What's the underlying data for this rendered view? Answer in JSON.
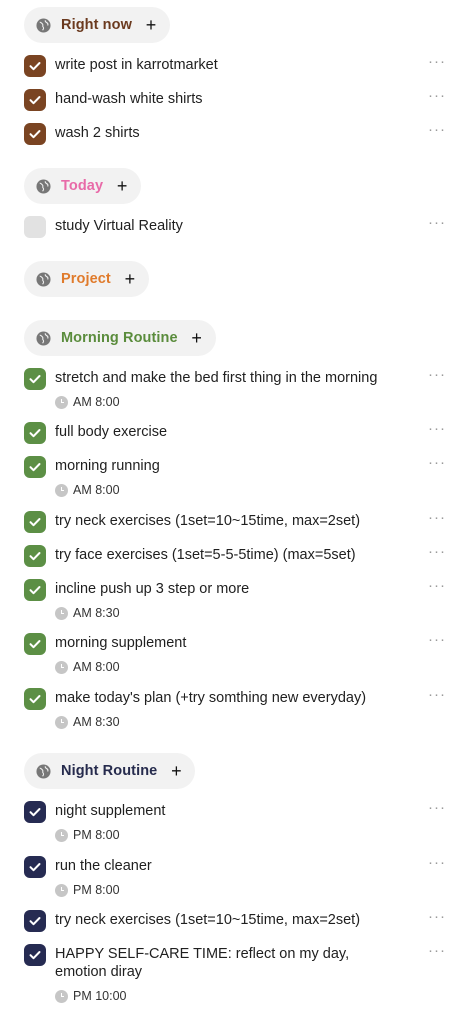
{
  "colors": {
    "right_now": "#6b3a1f",
    "today": "#e86aa8",
    "project": "#e07b2c",
    "morning": "#5a8c3c",
    "night": "#262b4d",
    "check_brown": "#7a4422",
    "check_green": "#5c8f45",
    "check_navy": "#262b52",
    "check_empty": "#e2e2e2"
  },
  "sections": {
    "right_now": {
      "title": "Right now",
      "plus": "+"
    },
    "today": {
      "title": "Today",
      "plus": "+"
    },
    "project": {
      "title": "Project",
      "plus": "+"
    },
    "morning": {
      "title": "Morning Routine",
      "plus": "+"
    },
    "night": {
      "title": "Night Routine",
      "plus": "+"
    }
  },
  "more_label": "···",
  "tasks": {
    "t1": {
      "title": "write post in karrotmarket",
      "done": true
    },
    "t2": {
      "title": "hand-wash white shirts",
      "done": true
    },
    "t3": {
      "title": "wash 2 shirts",
      "done": true
    },
    "t4": {
      "title": "study Virtual Reality",
      "done": false
    },
    "m1": {
      "title": "stretch and make the bed first thing in the morning",
      "time": "AM 8:00",
      "done": true
    },
    "m2": {
      "title": "full body exercise",
      "done": true
    },
    "m3": {
      "title": "morning running",
      "time": "AM 8:00",
      "done": true
    },
    "m4": {
      "title": "try neck exercises (1set=10~15time, max=2set)",
      "done": true
    },
    "m5": {
      "title": "try face exercises (1set=5-5-5time) (max=5set)",
      "done": true
    },
    "m6": {
      "title": "incline push up 3 step or more",
      "time": "AM 8:30",
      "done": true
    },
    "m7": {
      "title": "morning supplement",
      "time": "AM 8:00",
      "done": true
    },
    "m8": {
      "title": "make today's plan (+try somthing new everyday)",
      "time": "AM 8:30",
      "done": true
    },
    "n1": {
      "title": "night supplement",
      "time": "PM 8:00",
      "done": true
    },
    "n2": {
      "title": "run the cleaner",
      "time": "PM 8:00",
      "done": true
    },
    "n3": {
      "title": "try neck exercises (1set=10~15time, max=2set)",
      "done": true
    },
    "n4": {
      "title": "HAPPY SELF-CARE TIME: reflect on my day, emotion diray",
      "time": "PM 10:00",
      "done": true
    }
  }
}
